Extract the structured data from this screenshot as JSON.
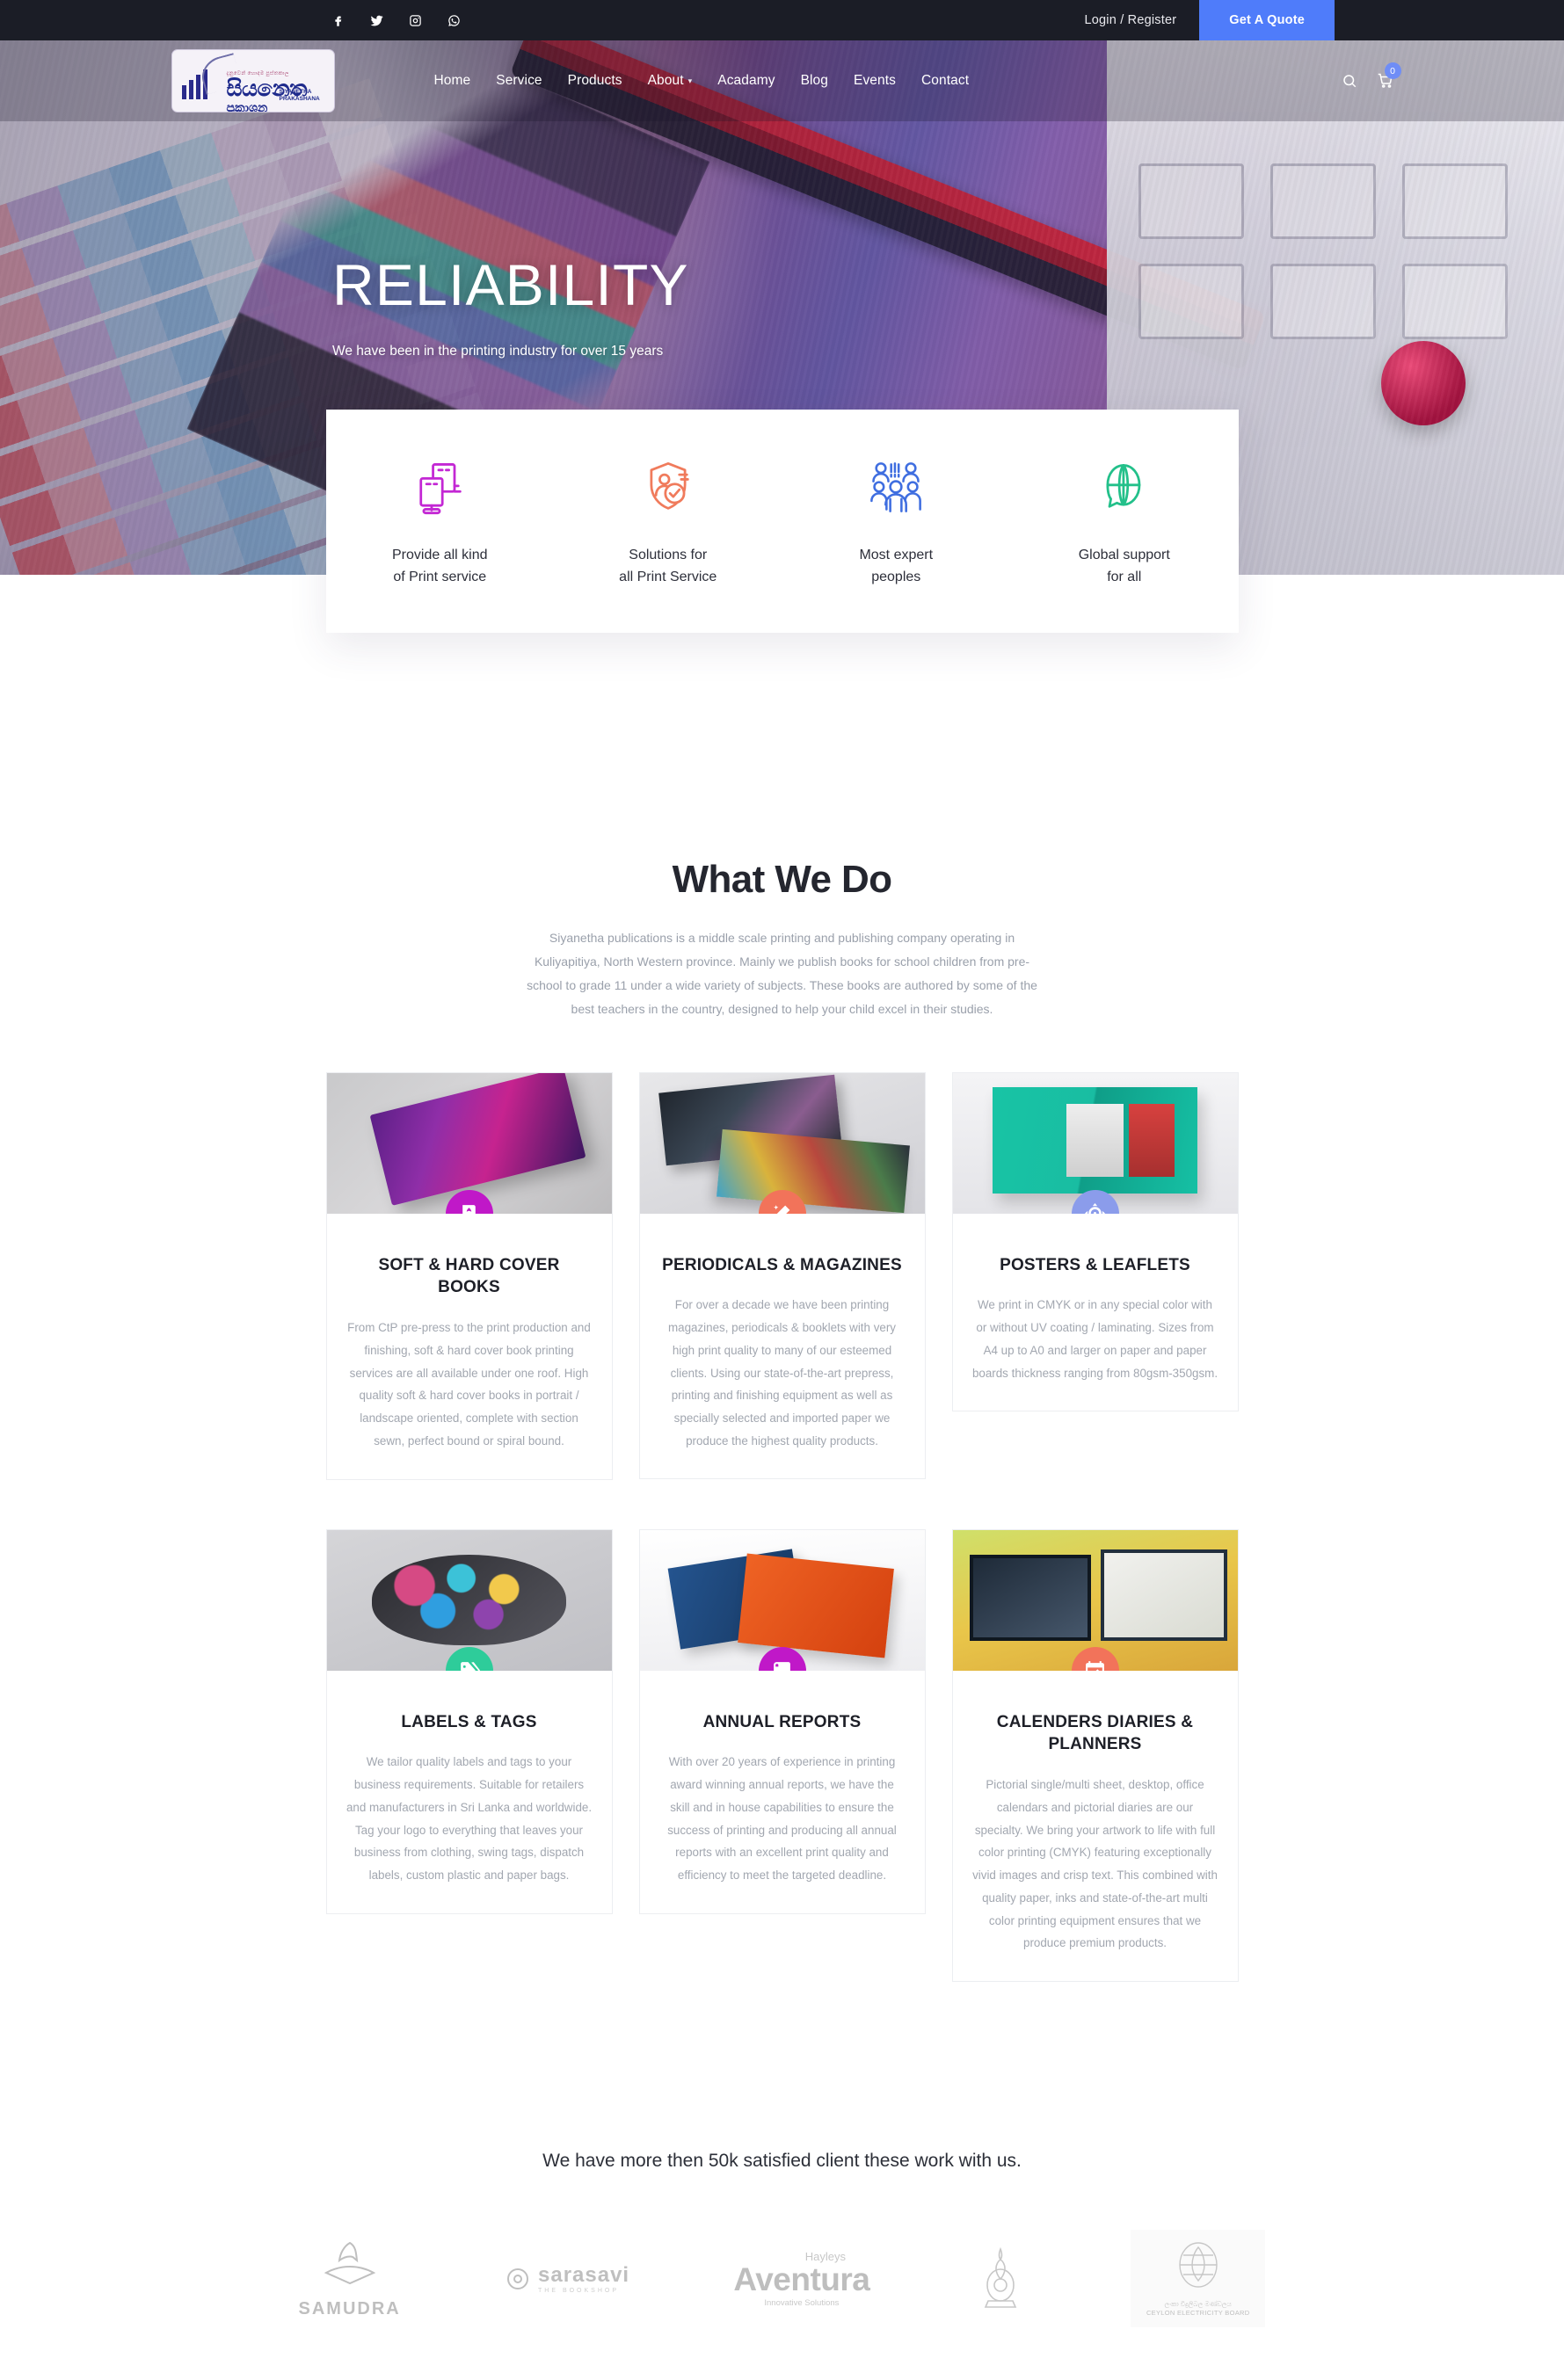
{
  "topbar": {
    "social": [
      {
        "name": "facebook-icon",
        "label": "Facebook"
      },
      {
        "name": "twitter-icon",
        "label": "Twitter"
      },
      {
        "name": "instagram-icon",
        "label": "Instagram"
      },
      {
        "name": "whatsapp-icon",
        "label": "WhatsApp"
      }
    ],
    "login_label": "Login / Register",
    "quote_label": "Get A Quote",
    "quote_color": "#4f7cfa",
    "bg_color": "#1b1d26"
  },
  "header": {
    "logo": {
      "top_line": "දැනුවෙන් හොඳම පුස්තකාල",
      "main": "සියනෙත",
      "sub": "ප්‍රකාශන",
      "en_line1": "SIYANETHA",
      "en_line2": "PRAKASHANA"
    },
    "nav": [
      {
        "label": "Home",
        "has_caret": false
      },
      {
        "label": "Service",
        "has_caret": false
      },
      {
        "label": "Products",
        "has_caret": false
      },
      {
        "label": "About",
        "has_caret": true
      },
      {
        "label": "Acadamy",
        "has_caret": false
      },
      {
        "label": "Blog",
        "has_caret": false
      },
      {
        "label": "Events",
        "has_caret": false
      },
      {
        "label": "Contact",
        "has_caret": false
      }
    ],
    "caret_glyph": "▾",
    "search_name": "search-icon",
    "cart_name": "cart-icon",
    "cart_count": "0"
  },
  "hero": {
    "title": "RELIABILITY",
    "subtitle": "We have been in the printing industry for over 15 years"
  },
  "features": [
    {
      "icon": "monitors-icon",
      "color": "#c327d4",
      "line1": "Provide all kind",
      "line2": "of Print service"
    },
    {
      "icon": "shield-user-check-icon",
      "color": "#f07b5c",
      "line1": "Solutions for",
      "line2": "all Print Service"
    },
    {
      "icon": "people-group-icon",
      "color": "#3f6ee0",
      "line1": "Most expert",
      "line2": "peoples"
    },
    {
      "icon": "globe-chat-icon",
      "color": "#23c08a",
      "line1": "Global support",
      "line2": "for all"
    }
  ],
  "what_we_do": {
    "title": "What We Do",
    "description": "Siyanetha publications is a middle scale printing and publishing company operating in Kuliyapitiya, North Western province. Mainly we publish books for school children from pre-school to grade 11 under a wide variety of subjects. These books are authored by some of the best teachers in the country, designed to help your child excel in their studies."
  },
  "services": [
    {
      "title": "SOFT & HARD COVER BOOKS",
      "text": "From CtP pre-press to the print production and finishing, soft & hard cover book printing services are all available under one roof. High quality soft & hard cover books in portrait / landscape oriented, complete with section sewn, perfect bound or spiral bound.",
      "badge_color": "#c018c8",
      "badge_icon": "book-icon",
      "thumb": "th1"
    },
    {
      "title": "PERIODICALS & MAGAZINES",
      "text": "For over a decade we have been printing magazines, periodicals & booklets with very high print quality to many of our esteemed clients. Using our state-of-the-art prepress, printing and finishing equipment as well as specially selected and imported paper we produce the highest quality products.",
      "badge_color": "#f2735a",
      "badge_icon": "magic-wand-icon",
      "thumb": "th2"
    },
    {
      "title": "POSTERS & LEAFLETS",
      "text": "We print in CMYK or in any special color with or without UV coating / laminating. Sizes from A4 up to A0 and larger on paper and paper boards thickness ranging from 80gsm-350gsm.",
      "badge_color": "#8b9ceb",
      "badge_icon": "crosshair-icon",
      "thumb": "th3"
    },
    {
      "title": "LABELS & TAGS",
      "text": "We tailor quality labels and tags to your business requirements. Suitable for retailers and manufacturers in Sri Lanka and worldwide. Tag your logo to everything that leaves your business from clothing, swing tags, dispatch labels, custom plastic and paper bags.",
      "badge_color": "#2ecc9a",
      "badge_icon": "tag-icon",
      "thumb": "th4"
    },
    {
      "title": "ANNUAL REPORTS",
      "text": "With over 20 years of experience in printing award winning annual reports, we have the skill and in house capabilities to ensure the success of printing and producing all annual reports with an excellent print quality and efficiency to meet the targeted deadline.",
      "badge_color": "#c018c8",
      "badge_icon": "scroll-icon",
      "thumb": "th5"
    },
    {
      "title": "CALENDERS DIARIES & PLANNERS",
      "text": "Pictorial single/multi sheet, desktop, office calendars and pictorial diaries are our specialty. We bring your artwork to life with full color printing (CMYK) featuring exceptionally vivid images and crisp text. This combined with quality paper, inks and state-of-the-art multi color printing equipment ensures that we produce premium products.",
      "badge_color": "#f2735a",
      "badge_icon": "calendar-check-icon",
      "thumb": "th6"
    }
  ],
  "clients": {
    "title": "We have more then 50k satisfied client these work with us.",
    "logos": [
      {
        "name": "SAMUDRA",
        "tagline": ""
      },
      {
        "name": "sarasavi",
        "tagline": "THE BOOKSHOP"
      },
      {
        "name": "Aventura",
        "tagline": "Innovative Solutions",
        "super": "Hayleys"
      },
      {
        "name": "",
        "tagline": ""
      },
      {
        "name": "CEYLON ELECTRICITY BOARD",
        "tagline": "ලංකා විදුලිබල මණ්ඩලය"
      }
    ]
  }
}
